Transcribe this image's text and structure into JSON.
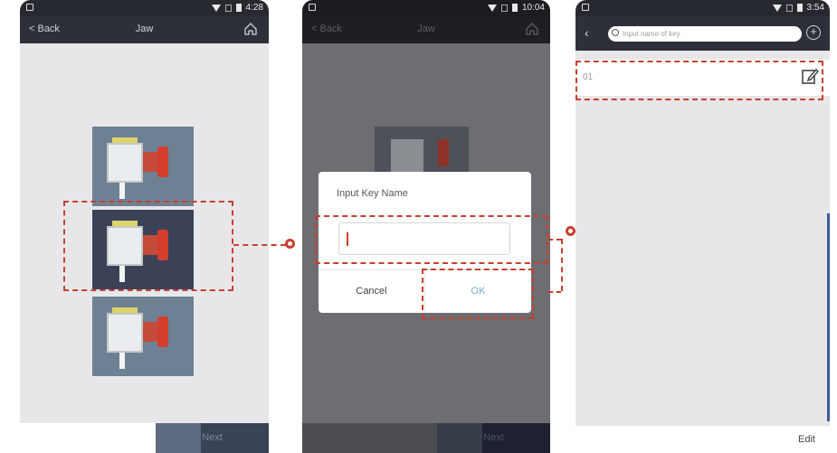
{
  "screen1": {
    "back_label": "< Back",
    "title": "Jaw",
    "time": "4:28",
    "next_label": "Next"
  },
  "screen2": {
    "back_label": "< Back",
    "title": "Jaw",
    "time": "10:04",
    "dialog_title": "Input Key Name",
    "cancel_label": "Cancel",
    "ok_label": "OK",
    "next_label": "Next"
  },
  "screen3": {
    "time": "3:54",
    "search_placeholder": "Input name of key",
    "row_label": "01",
    "edit_label": "Edit"
  },
  "accent_color": "#c7402f"
}
